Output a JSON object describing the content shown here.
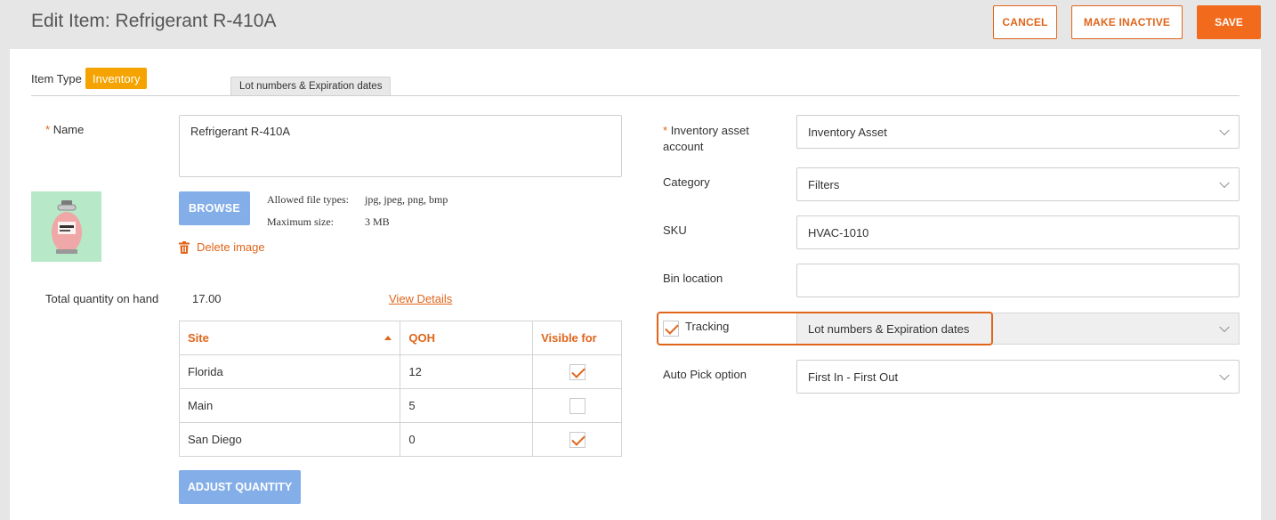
{
  "header": {
    "title": "Edit Item: Refrigerant R-410A",
    "cancel_label": "CANCEL",
    "make_inactive_label": "MAKE INACTIVE",
    "save_label": "SAVE"
  },
  "item_type": {
    "label": "Item Type",
    "value": "Inventory"
  },
  "tooltip": "Lot numbers & Expiration dates",
  "left": {
    "name_required": "*",
    "name_label": "Name",
    "name_value": "Refrigerant R-410A",
    "browse_label": "BROWSE",
    "allowed_label": "Allowed file types:",
    "allowed_value": "jpg, jpeg, png, bmp",
    "max_label": "Maximum size:",
    "max_value": "3 MB",
    "delete_label": "Delete image",
    "total_label": "Total quantity on hand",
    "total_value": "17.00",
    "view_details": "View Details",
    "table": {
      "headers": [
        "Site",
        "QOH",
        "Visible for"
      ],
      "rows": [
        {
          "site": "Florida",
          "qoh": "12",
          "visible": true
        },
        {
          "site": "Main",
          "qoh": "5",
          "visible": false
        },
        {
          "site": "San Diego",
          "qoh": "0",
          "visible": true
        }
      ]
    },
    "adjust_label": "ADJUST QUANTITY"
  },
  "right": {
    "asset_required": "*",
    "asset_label_1": "Inventory asset",
    "asset_label_2": "account",
    "asset_value": "Inventory Asset",
    "category_label": "Category",
    "category_value": "Filters",
    "sku_label": "SKU",
    "sku_value": "HVAC-1010",
    "bin_label": "Bin location",
    "bin_value": "",
    "tracking_label": "Tracking",
    "tracking_checked": true,
    "tracking_value": "Lot numbers & Expiration dates",
    "autopick_label": "Auto Pick option",
    "autopick_value": "First In - First Out"
  },
  "icons": {
    "product_image": "refrigerant-cylinder-icon",
    "delete": "trash-icon",
    "select": "chevron-down-icon",
    "sort": "sort-asc-icon"
  },
  "colors": {
    "accent": "#e0651b",
    "save": "#f26a1b",
    "badge": "#f5a300",
    "blue_button": "#84aee8",
    "thumb_bg": "#b7e8c7"
  }
}
